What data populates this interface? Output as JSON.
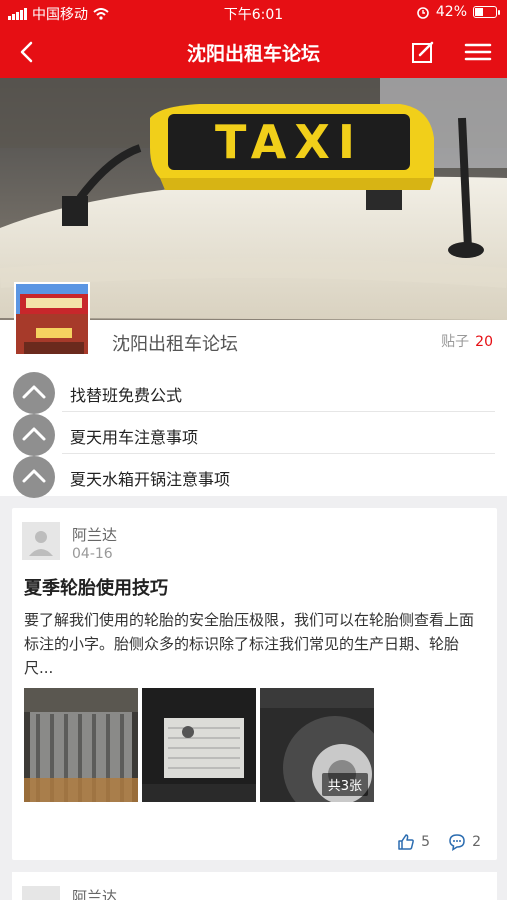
{
  "status_bar": {
    "carrier": "中国移动",
    "time": "下午6:01",
    "battery": "42%",
    "battery_level": 0.42
  },
  "nav": {
    "title": "沈阳出租车论坛",
    "back_icon": "chevron-left-icon",
    "edit_icon": "edit-icon",
    "menu_icon": "hamburger-menu-icon"
  },
  "banner": {
    "sign_text": "TAXI"
  },
  "forum": {
    "name": "沈阳出租车论坛",
    "posts_label": "贴子",
    "posts_count": "20"
  },
  "pinned": [
    {
      "title": "找替班免费公式"
    },
    {
      "title": "夏天用车注意事项"
    },
    {
      "title": "夏天水箱开锅注意事项"
    }
  ],
  "posts": [
    {
      "author": "阿兰达",
      "date": "04-16",
      "title": "夏季轮胎使用技巧",
      "excerpt": "要了解我们使用的轮胎的安全胎压极限，我们可以在轮胎侧查看上面标注的小字。胎侧众多的标识除了标注我们常见的生产日期、轮胎尺...",
      "image_count_label": "共3张",
      "likes": "5",
      "comments": "2"
    },
    {
      "author": "阿兰达"
    }
  ],
  "colors": {
    "brand_red": "#e60f14",
    "taxi_yellow": "#f1cf1a"
  }
}
